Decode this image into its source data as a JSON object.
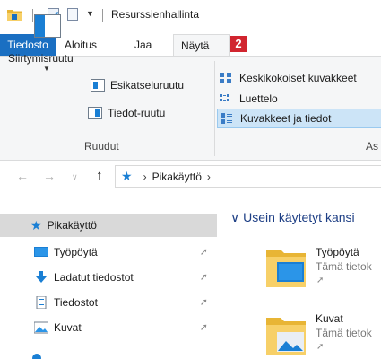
{
  "window": {
    "title": "Resurssienhallinta"
  },
  "ribbon": {
    "tabs": [
      "Tiedosto",
      "Aloitus",
      "Jaa",
      "Näytä"
    ],
    "badge": "2",
    "panes": {
      "navigation_pane": "Siirtymisruutu",
      "preview_pane": "Esikatseluruutu",
      "details_pane": "Tiedot-ruutu",
      "group_label": "Ruudut"
    },
    "layout": {
      "items": [
        "Keskikokoiset kuvakkeet",
        "Luettelo",
        "Kuvakkeet ja tiedot"
      ],
      "selected": "Kuvakkeet ja tiedot",
      "group_label": "As"
    }
  },
  "address": {
    "crumb": "Pikakäyttö"
  },
  "navpane": {
    "quick_access": "Pikakäyttö",
    "items": [
      "Työpöytä",
      "Ladatut tiedostot",
      "Tiedostot",
      "Kuvat"
    ]
  },
  "content": {
    "section_title": "Usein käytetyt kansi",
    "tiles": [
      {
        "name": "Työpöytä",
        "subtitle": "Tämä tietok"
      },
      {
        "name": "Kuvat",
        "subtitle": "Tämä tietok"
      }
    ]
  },
  "colors": {
    "accent": "#1a6fc2",
    "badge": "#d1252f",
    "selection": "#cce4f7",
    "folder": "#f5c842"
  }
}
